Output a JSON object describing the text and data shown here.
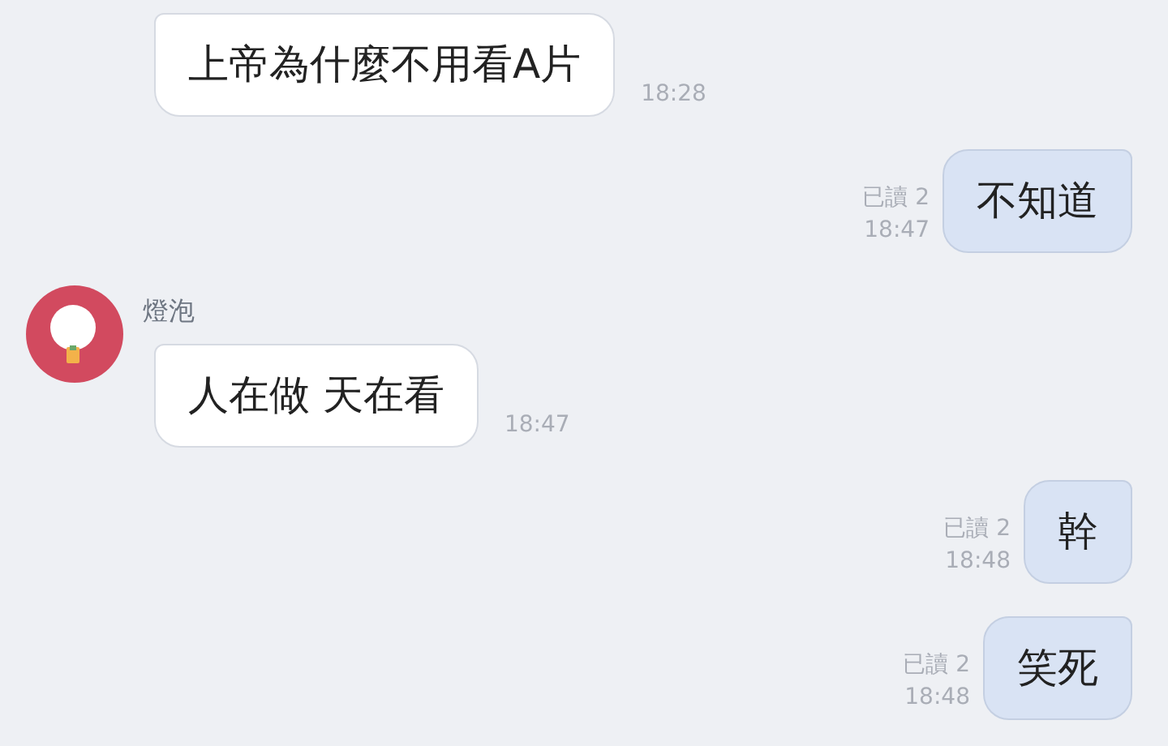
{
  "messages": [
    {
      "kind": "incoming",
      "text": "上帝為什麼不用看A片",
      "time": "18:28"
    },
    {
      "kind": "outgoing",
      "text": "不知道",
      "read": "已讀 2",
      "time": "18:47"
    },
    {
      "kind": "incoming",
      "sender": "燈泡",
      "text": "人在做 天在看",
      "time": "18:47"
    },
    {
      "kind": "outgoing",
      "text": "幹",
      "read": "已讀 2",
      "time": "18:48"
    },
    {
      "kind": "outgoing",
      "text": "笑死",
      "read": "已讀 2",
      "time": "18:48"
    }
  ]
}
